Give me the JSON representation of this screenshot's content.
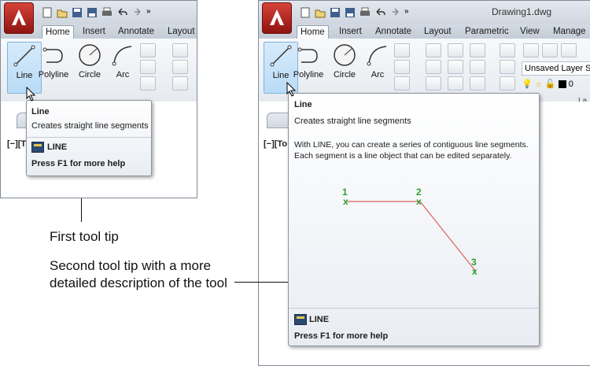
{
  "left_panel": {
    "tabs": [
      {
        "label": "Home",
        "active": true
      },
      {
        "label": "Insert",
        "active": false
      },
      {
        "label": "Annotate",
        "active": false
      },
      {
        "label": "Layout",
        "active": false
      }
    ],
    "tools": [
      "Line",
      "Polyline",
      "Circle",
      "Arc"
    ],
    "viewport_label": "[−][T",
    "tooltip": {
      "title": "Line",
      "description": "Creates straight line segments",
      "command": "LINE",
      "help": "Press F1 for more help"
    }
  },
  "right_panel": {
    "document_title": "Drawing1.dwg",
    "tabs": [
      {
        "label": "Home",
        "active": true
      },
      {
        "label": "Insert",
        "active": false
      },
      {
        "label": "Annotate",
        "active": false
      },
      {
        "label": "Layout",
        "active": false
      },
      {
        "label": "Parametric",
        "active": false
      },
      {
        "label": "View",
        "active": false
      },
      {
        "label": "Manage",
        "active": false
      }
    ],
    "tools": [
      "Line",
      "Polyline",
      "Circle",
      "Arc"
    ],
    "layer_state": "Unsaved Layer St",
    "layer_value": "0",
    "group_label": "La",
    "viewport_label": "[−][To",
    "tooltip": {
      "title": "Line",
      "description": "Creates straight line segments",
      "details": [
        "With LINE, you can create a series of contiguous line segments.",
        "Each segment is a line object that can be edited separately."
      ],
      "diagram_points": [
        "1",
        "2",
        "3"
      ],
      "command": "LINE",
      "help": "Press F1 for more help"
    }
  },
  "callouts": {
    "first": "First tool tip",
    "second_line1": "Second tool tip with a more",
    "second_line2": "detailed description of the tool"
  },
  "colors": {
    "app_button": "#c0271f",
    "diagram_line": "#e0605c",
    "diagram_marker": "#2ca02c",
    "highlight": "#b9dbf6"
  }
}
